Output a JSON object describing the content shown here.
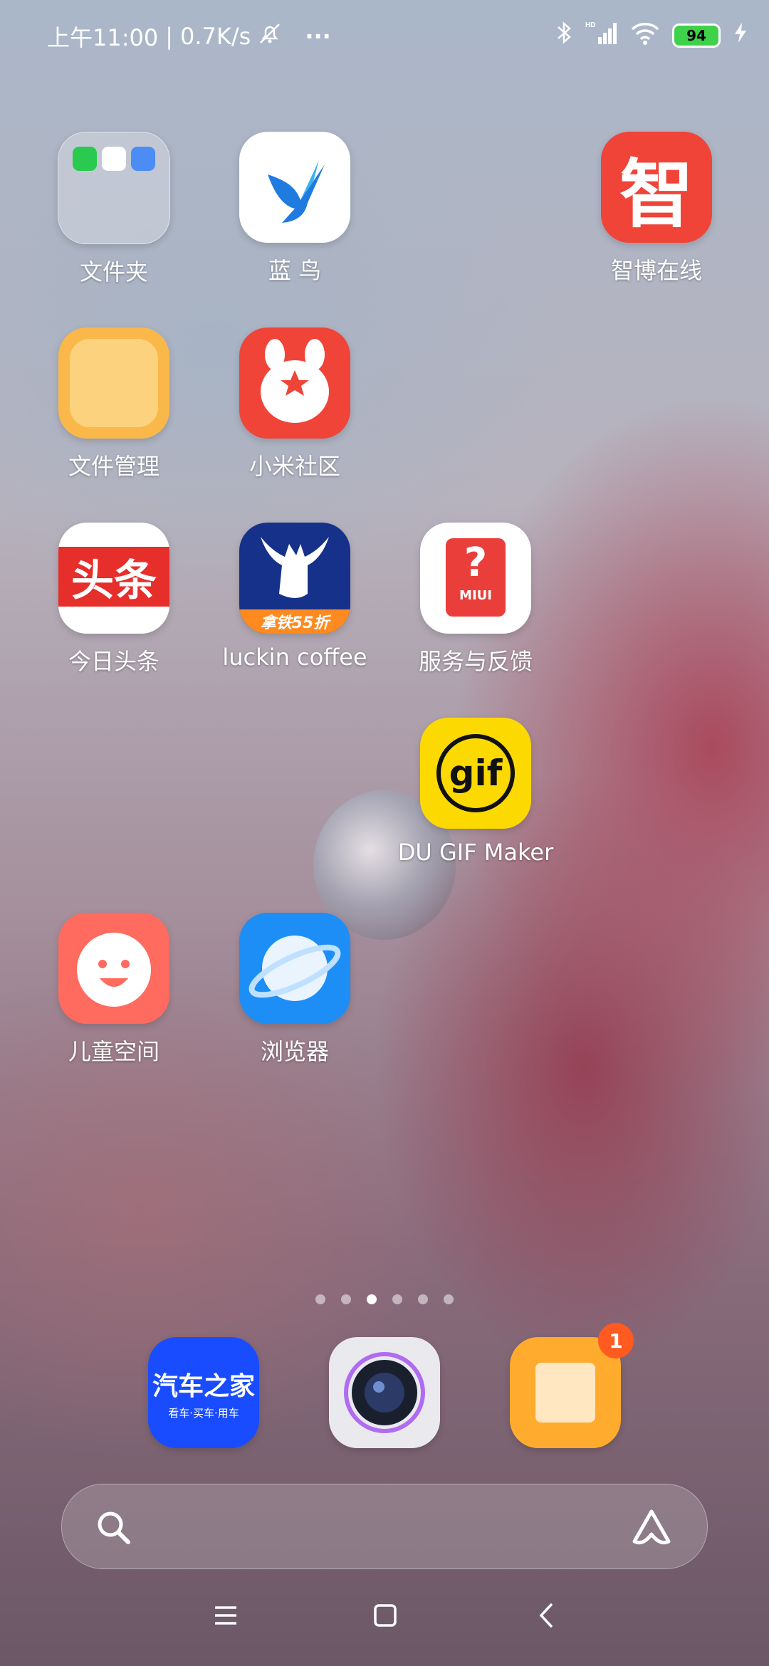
{
  "status_bar": {
    "time": "上午11:00",
    "separator": "|",
    "net_speed": "0.7K/s",
    "more": "···",
    "battery_level": "94",
    "icons": [
      "alarm-off-icon",
      "bluetooth-icon",
      "hd-signal-icon",
      "wifi-icon",
      "battery-icon",
      "charging-icon"
    ]
  },
  "apps": [
    {
      "label": "文件夹"
    },
    {
      "label": "蓝 鸟"
    },
    {
      "label": "智博在线",
      "glyph": "智"
    },
    {
      "label": "文件管理"
    },
    {
      "label": "小米社区"
    },
    {
      "label": "今日头条",
      "glyph": "头条"
    },
    {
      "label": "luckin coffee",
      "glyph": "拿铁55折"
    },
    {
      "label": "服务与反馈",
      "glyph": "MIUI"
    },
    {
      "label": "DU GIF Maker",
      "glyph": "gif"
    },
    {
      "label": "儿童空间"
    },
    {
      "label": "浏览器"
    }
  ],
  "page_indicator": {
    "count": 6,
    "active": 2
  },
  "dock": [
    {
      "name": "汽车之家",
      "sub": "看车·买车·用车"
    },
    {
      "name": "camera"
    },
    {
      "name": "notes",
      "badge": "1"
    }
  ],
  "colors": {
    "accent_red": "#f04438",
    "badge": "#ff5a1f",
    "battery": "#3fd14a"
  }
}
